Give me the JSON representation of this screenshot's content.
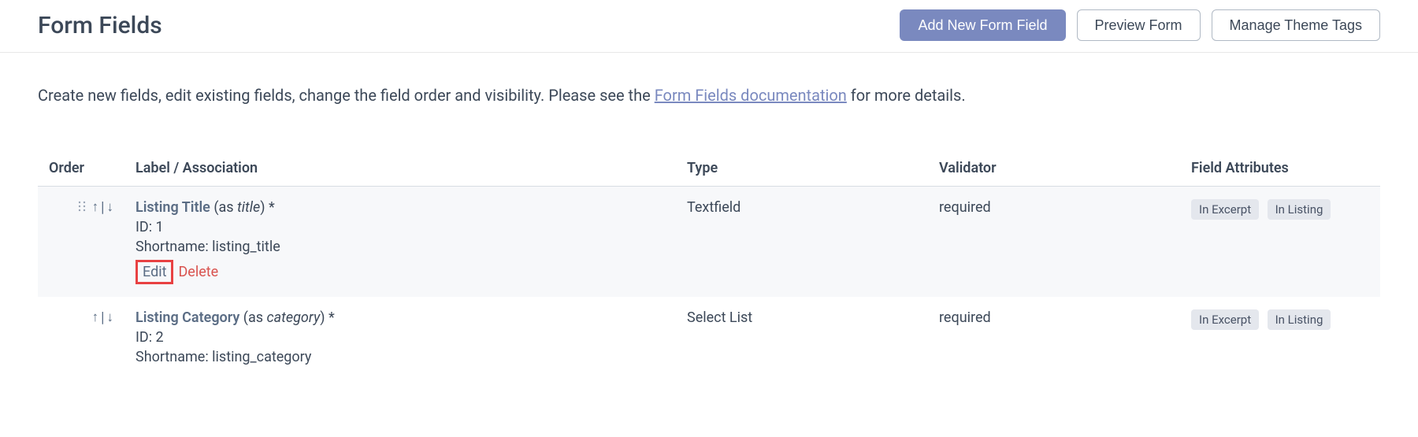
{
  "header": {
    "title": "Form Fields",
    "add_button": "Add New Form Field",
    "preview_button": "Preview Form",
    "manage_button": "Manage Theme Tags"
  },
  "description": {
    "text_before": "Create new fields, edit existing fields, change the field order and visibility. Please see the ",
    "link_text": "Form Fields documentation",
    "text_after": " for more details."
  },
  "table": {
    "headers": {
      "order": "Order",
      "label": "Label / Association",
      "type": "Type",
      "validator": "Validator",
      "attributes": "Field Attributes"
    },
    "rows": [
      {
        "label": "Listing Title",
        "as_before": " (as ",
        "as_value": "title",
        "as_after": ") ",
        "required_mark": "*",
        "id_label": "ID: 1",
        "shortname_label": "Shortname: listing_title",
        "edit": "Edit",
        "delete": "Delete",
        "type": "Textfield",
        "validator": "required",
        "badge1": "In Excerpt",
        "badge2": "In Listing"
      },
      {
        "label": "Listing Category",
        "as_before": " (as ",
        "as_value": "category",
        "as_after": ") ",
        "required_mark": "*",
        "id_label": "ID: 2",
        "shortname_label": "Shortname: listing_category",
        "type": "Select List",
        "validator": "required",
        "badge1": "In Excerpt",
        "badge2": "In Listing"
      }
    ]
  }
}
